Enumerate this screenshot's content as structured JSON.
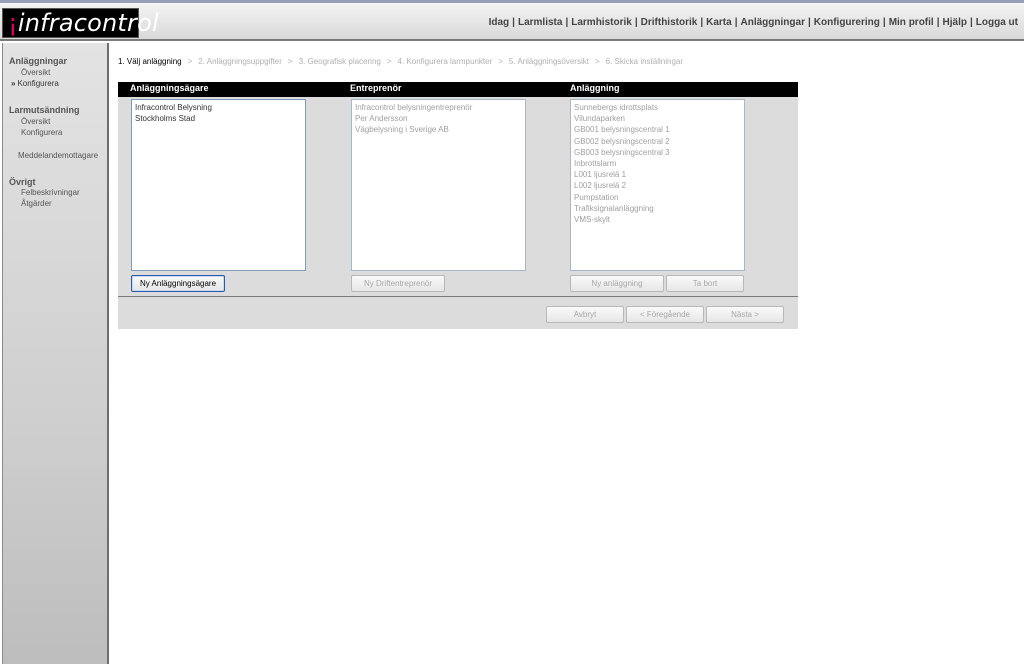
{
  "header": {
    "logo": "infracontrol",
    "nav": [
      "Idag",
      "Larmlista",
      "Larmhistorik",
      "Drifthistorik",
      "Karta",
      "Anläggningar",
      "Konfigurering",
      "Min profil",
      "Hjälp",
      "Logga ut"
    ]
  },
  "sidebar": {
    "section1": "Anläggningar",
    "s1_overview": "Översikt",
    "s1_configure": "Konfigurera",
    "section2": "Larmutsändning",
    "s2_overview": "Översikt",
    "s2_configure": "Konfigurera",
    "recipients": "Meddelandemottagare",
    "section3": "Övrigt",
    "fault_descriptions": "Felbeskrivningar",
    "actions": "Åtgärder"
  },
  "wizard": {
    "steps": [
      "1. Välj anläggning",
      "2. Anläggningsuppgifter",
      "3. Geografisk placering",
      "4. Konfigurera larmpunkter",
      "5. Anläggningsöversikt",
      "6. Skicka inställningar"
    ],
    "separator": ">"
  },
  "columns": {
    "owner_title": "Anläggningsägare",
    "contractor_title": "Entreprenör",
    "facility_title": "Anläggning"
  },
  "owners": [
    "Infracontrol Belysning",
    "Stockholms Stad"
  ],
  "contractors": [
    "Infracontrol belysningentreprenör",
    "Per Andersson",
    "Vägbelysning i Sverige AB"
  ],
  "facilities": [
    "Sunnebergs idrottsplats",
    "Vilundaparken",
    "GB001 belysningscentral 1",
    "GB002 belysningscentral 2",
    "GB003 belysningscentral 3",
    "Inbrottslarm",
    "L001 ljusrelä 1",
    "L002 ljusrelä 2",
    "Pumpstation",
    "Trafiksignalanläggning",
    "VMS-skylt"
  ],
  "buttons": {
    "new_owner": "Ny Anläggningsägare",
    "new_contractor": "Ny Driftentreprenör",
    "new_facility": "Ny anläggning",
    "remove": "Ta bort",
    "cancel": "Avbryt",
    "previous": "< Föregående",
    "next": "Nästa >"
  }
}
